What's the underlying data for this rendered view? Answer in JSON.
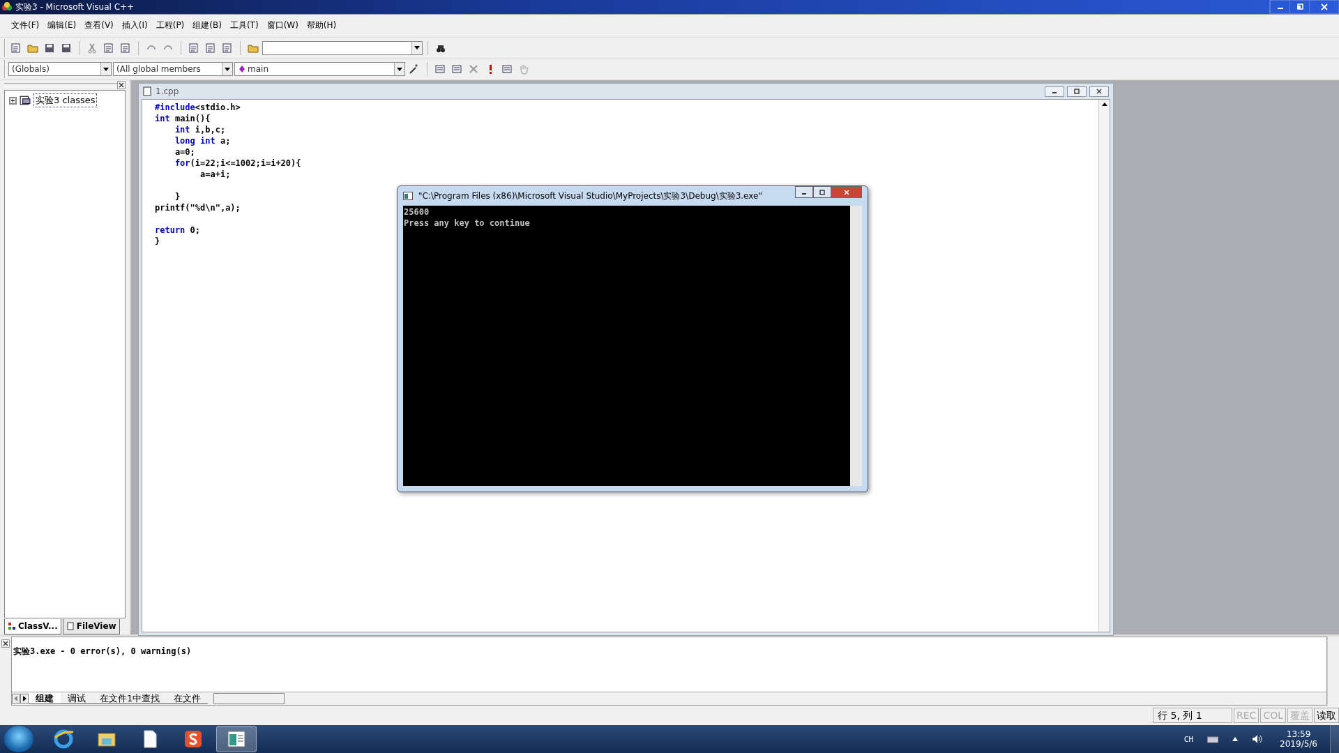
{
  "window": {
    "title": "实验3 - Microsoft Visual C++"
  },
  "menu": [
    "文件(F)",
    "编辑(E)",
    "查看(V)",
    "插入(I)",
    "工程(P)",
    "组建(B)",
    "工具(T)",
    "窗口(W)",
    "帮助(H)"
  ],
  "wizard_bar": {
    "class_combo": "(Globals)",
    "members_combo": "(All global members",
    "function_combo": "main"
  },
  "workspace": {
    "tree": [
      {
        "label": "实验3 classes",
        "expanded": false,
        "selected": true
      }
    ],
    "tabs": [
      {
        "label": "ClassV...",
        "selected": true
      },
      {
        "label": "FileView",
        "selected": false
      }
    ]
  },
  "editor": {
    "title": "1.cpp",
    "lines": [
      {
        "blank_before": false,
        "segments": [
          {
            "kind": "keyword",
            "text": "#include"
          },
          {
            "kind": "plain",
            "text": "<stdio.h>"
          }
        ]
      },
      {
        "blank_before": false,
        "segments": [
          {
            "kind": "keyword",
            "text": "int"
          },
          {
            "kind": "plain",
            "text": " main(){"
          }
        ]
      },
      {
        "blank_before": false,
        "segments": [
          {
            "kind": "keyword",
            "text": "    int"
          },
          {
            "kind": "plain",
            "text": " i,b,c;"
          }
        ]
      },
      {
        "blank_before": false,
        "segments": [
          {
            "kind": "keyword",
            "text": "    long"
          },
          {
            "kind": "keyword",
            "text": " int"
          },
          {
            "kind": "plain",
            "text": " a;"
          }
        ]
      },
      {
        "blank_before": false,
        "segments": [
          {
            "kind": "plain",
            "text": "    a=0;"
          }
        ]
      },
      {
        "blank_before": false,
        "segments": [
          {
            "kind": "keyword",
            "text": "    for"
          },
          {
            "kind": "plain",
            "text": "(i=22;i<=1002;i=i+20){"
          }
        ]
      },
      {
        "blank_before": false,
        "segments": [
          {
            "kind": "plain",
            "text": "         a=a+i;"
          }
        ]
      },
      {
        "blank_before": true,
        "segments": [
          {
            "kind": "plain",
            "text": "    }"
          }
        ]
      },
      {
        "blank_before": false,
        "segments": [
          {
            "kind": "plain",
            "text": "printf(\"%d\\n\",a);"
          }
        ]
      },
      {
        "blank_before": true,
        "segments": [
          {
            "kind": "keyword",
            "text": "return"
          },
          {
            "kind": "plain",
            "text": " 0;"
          }
        ]
      },
      {
        "blank_before": false,
        "segments": [
          {
            "kind": "plain",
            "text": "}"
          }
        ]
      }
    ]
  },
  "console": {
    "title": "\"C:\\Program Files (x86)\\Microsoft Visual Studio\\MyProjects\\实验3\\Debug\\实验3.exe\"",
    "lines": [
      "25600",
      "Press any key to continue"
    ]
  },
  "output": {
    "lines": [
      "实验3.exe - 0 error(s), 0 warning(s)"
    ],
    "tabs": [
      {
        "label": "组建",
        "selected": true
      },
      {
        "label": "调试",
        "selected": false
      },
      {
        "label": "在文件1中查找",
        "selected": false
      },
      {
        "label": "在文件",
        "selected": false
      }
    ]
  },
  "status_bar": {
    "position": "行 5, 列 1",
    "indicators": [
      {
        "label": "REC",
        "disabled": true
      },
      {
        "label": "COL",
        "disabled": true
      },
      {
        "label": "覆盖",
        "disabled": true
      },
      {
        "label": "读取",
        "disabled": false
      }
    ]
  },
  "taskbar": {
    "apps": [
      {
        "selected": false
      },
      {
        "selected": false
      },
      {
        "selected": false
      },
      {
        "selected": false
      },
      {
        "selected": true
      }
    ],
    "ime": "CH",
    "time": "13:59",
    "date": "2019/5/6"
  }
}
